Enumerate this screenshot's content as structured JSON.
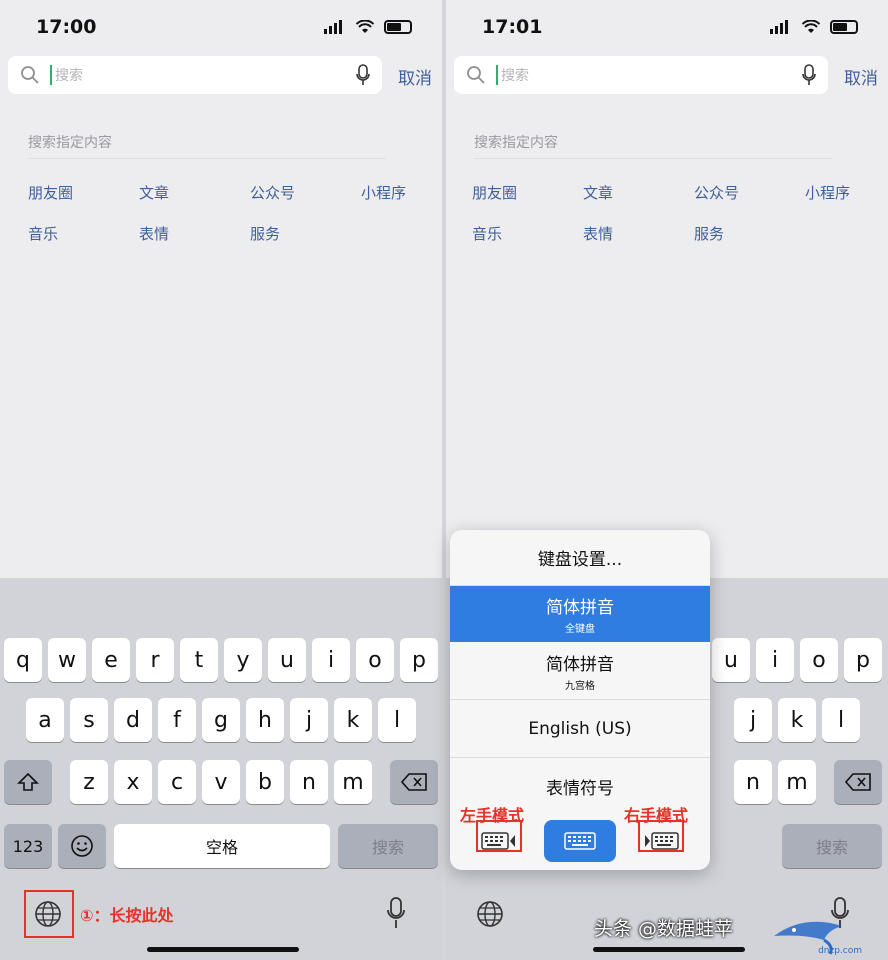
{
  "left": {
    "status_time": "17:00",
    "search_placeholder": "搜索",
    "cancel_label": "取消",
    "specify_title": "搜索指定内容",
    "categories": [
      "朋友圈",
      "文章",
      "公众号",
      "小程序",
      "音乐",
      "表情",
      "服务"
    ],
    "keyboard": {
      "row1": [
        "q",
        "w",
        "e",
        "r",
        "t",
        "y",
        "u",
        "i",
        "o",
        "p"
      ],
      "row2": [
        "a",
        "s",
        "d",
        "f",
        "g",
        "h",
        "j",
        "k",
        "l"
      ],
      "row3": [
        "z",
        "x",
        "c",
        "v",
        "b",
        "n",
        "m"
      ],
      "num_label": "123",
      "space_label": "空格",
      "search_label": "搜索"
    },
    "annotation": "①：长按此处"
  },
  "right": {
    "status_time": "17:01",
    "search_placeholder": "搜索",
    "cancel_label": "取消",
    "specify_title": "搜索指定内容",
    "categories": [
      "朋友圈",
      "文章",
      "公众号",
      "小程序",
      "音乐",
      "表情",
      "服务"
    ],
    "visible_keys": {
      "row1": [
        "u",
        "i",
        "o",
        "p"
      ],
      "row2": [
        "j",
        "k",
        "l"
      ],
      "row3": [
        "n",
        "m"
      ]
    },
    "search_label": "搜索",
    "popup": {
      "settings": "键盘设置...",
      "items": [
        {
          "main": "简体拼音",
          "sub": "全键盘",
          "selected": true
        },
        {
          "main": "简体拼音",
          "sub": "九宫格",
          "selected": false
        },
        {
          "main": "English (US)",
          "sub": "",
          "selected": false
        },
        {
          "main": "表情符号",
          "sub": "",
          "selected": false
        }
      ],
      "left_mode": "左手模式",
      "right_mode": "右手模式"
    }
  },
  "watermark": "头条 @数据蛙苹",
  "watermark_site": "dnzp.com",
  "colors": {
    "accent_blue": "#2f7de1",
    "annotation_red": "#e5332a",
    "link_blue": "#3f5f98"
  }
}
